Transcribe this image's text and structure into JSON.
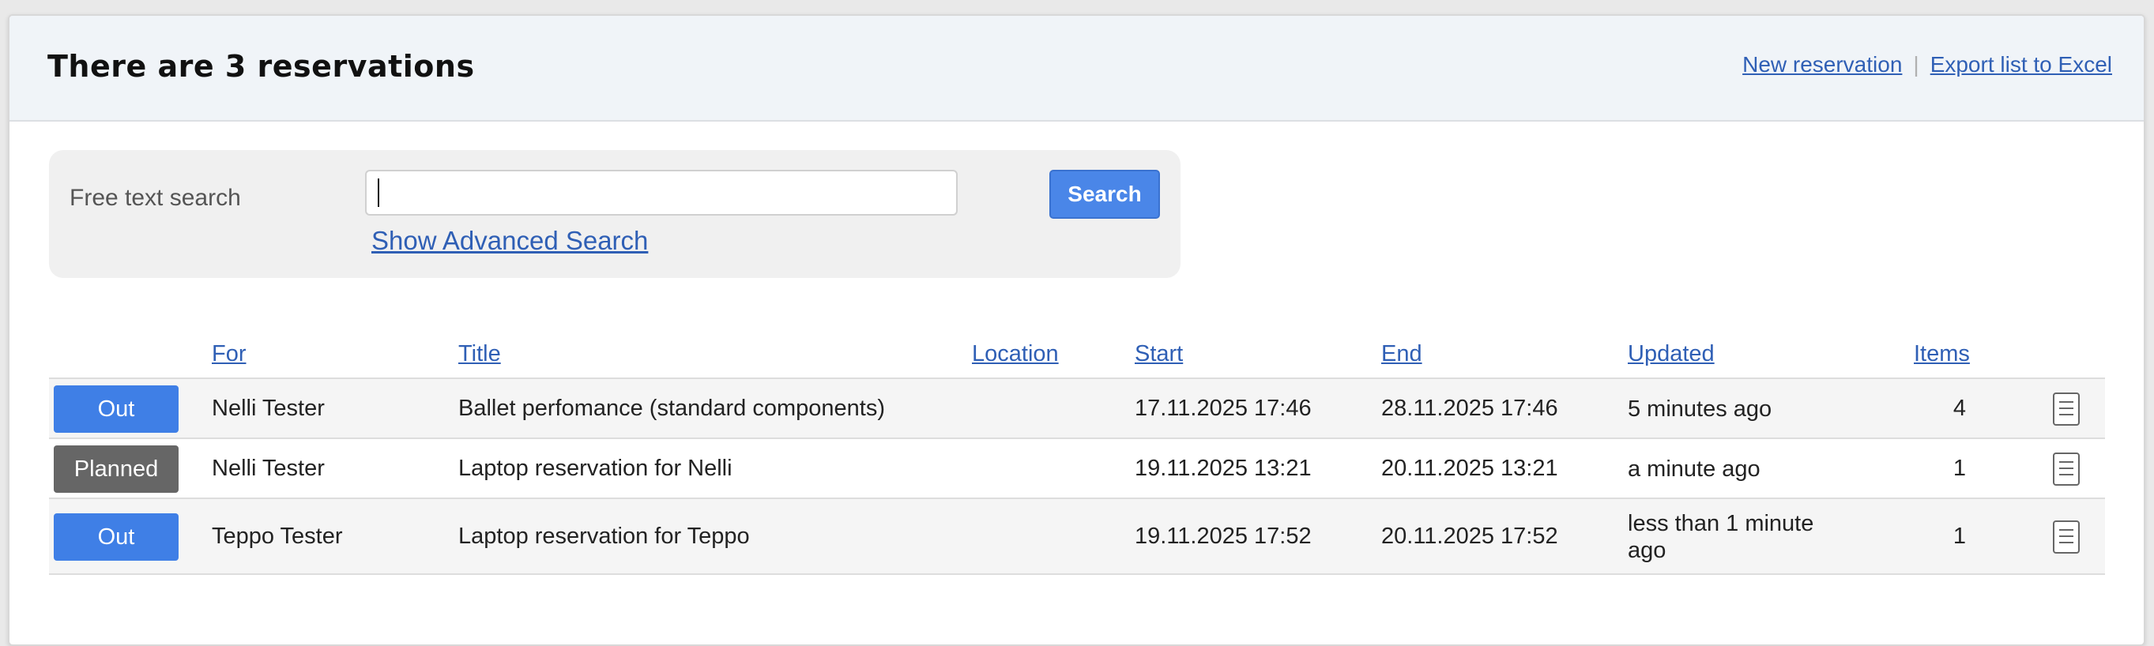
{
  "header": {
    "title": "There are 3 reservations",
    "new_reservation": "New reservation",
    "separator": "|",
    "export": "Export list to Excel"
  },
  "search": {
    "label": "Free text search",
    "value": "",
    "button": "Search",
    "advanced": "Show Advanced Search"
  },
  "columns": {
    "for": "For",
    "title": "Title",
    "location": "Location",
    "start": "Start",
    "end": "End",
    "updated": "Updated",
    "items": "Items"
  },
  "colors": {
    "out": "#3f7fe6",
    "planned": "#666666",
    "link": "#2f5fb5"
  },
  "rows": [
    {
      "status": "Out",
      "status_color": "#3f7fe6",
      "for": "Nelli Tester",
      "title": "Ballet perfomance (standard components)",
      "location": "",
      "start": "17.11.2025 17:46",
      "end": "28.11.2025 17:46",
      "updated": "5 minutes ago",
      "items": "4",
      "icon": "document-icon"
    },
    {
      "status": "Planned",
      "status_color": "#666666",
      "for": "Nelli Tester",
      "title": "Laptop reservation for Nelli",
      "location": "",
      "start": "19.11.2025 13:21",
      "end": "20.11.2025 13:21",
      "updated": "a minute ago",
      "items": "1",
      "icon": "document-icon"
    },
    {
      "status": "Out",
      "status_color": "#3f7fe6",
      "for": "Teppo Tester",
      "title": "Laptop reservation for Teppo",
      "location": "",
      "start": "19.11.2025 17:52",
      "end": "20.11.2025 17:52",
      "updated": "less than 1 minute ago",
      "items": "1",
      "icon": "document-icon"
    }
  ]
}
